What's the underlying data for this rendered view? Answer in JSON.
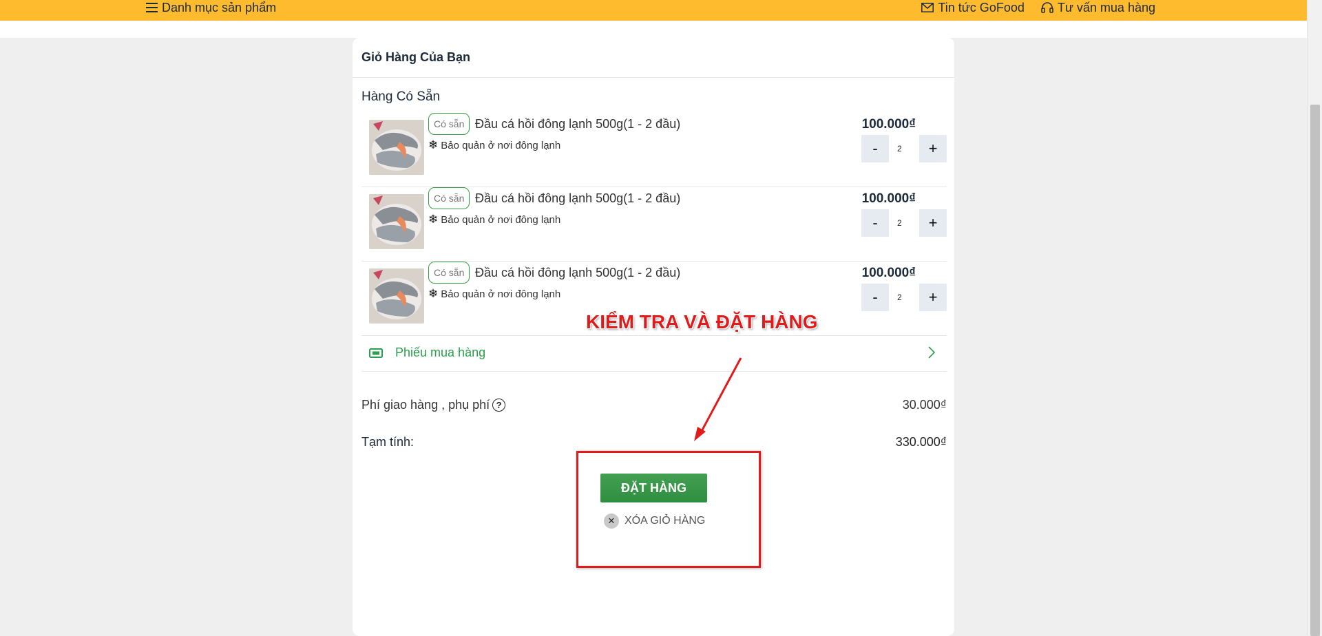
{
  "topbar": {
    "menu_label": "Danh mục sản phẩm",
    "news_label": "Tin tức GoFood",
    "consult_label": "Tư vấn mua hàng",
    "bg_color": "#fdbb2d"
  },
  "cart": {
    "title": "Giỏ Hàng Của Bạn",
    "section_title": "Hàng Có Sẵn",
    "items": [
      {
        "badge": "Có sẵn",
        "name": "Đầu cá hồi đông lạnh 500g(1 - 2 đầu)",
        "storage": "Bảo quản ở nơi đông lạnh",
        "price": "100.000₫",
        "qty": "2",
        "minus": "-",
        "plus": "+"
      },
      {
        "badge": "Có sẵn",
        "name": "Đầu cá hồi đông lạnh 500g(1 - 2 đầu)",
        "storage": "Bảo quản ở nơi đông lạnh",
        "price": "100.000₫",
        "qty": "2",
        "minus": "-",
        "plus": "+"
      },
      {
        "badge": "Có sẵn",
        "name": "Đầu cá hồi đông lạnh 500g(1 - 2 đầu)",
        "storage": "Bảo quản ở nơi đông lạnh",
        "price": "100.000₫",
        "qty": "2",
        "minus": "-",
        "plus": "+"
      }
    ],
    "voucher_label": "Phiếu mua hàng",
    "fee_label": "Phí giao hàng , phụ phí",
    "fee_help": "?",
    "fee_value": "30.000₫",
    "subtotal_label": "Tạm tính:",
    "subtotal_value": "330.000₫",
    "order_button": "ĐẶT HÀNG",
    "clear_button": "XÓA GIỎ HÀNG",
    "accent_green": "#2a9f4c"
  },
  "annotation": {
    "text": "KIỂM TRA VÀ ĐẶT HÀNG",
    "color": "#e01b1b"
  },
  "icons": {
    "menu": "hamburger-icon",
    "news": "envelope-icon",
    "consult": "headset-icon",
    "storage": "snowflake-icon",
    "voucher": "ticket-icon",
    "chevron": "chevron-right-icon",
    "help": "question-circle-icon",
    "clear": "close-circle-icon"
  }
}
